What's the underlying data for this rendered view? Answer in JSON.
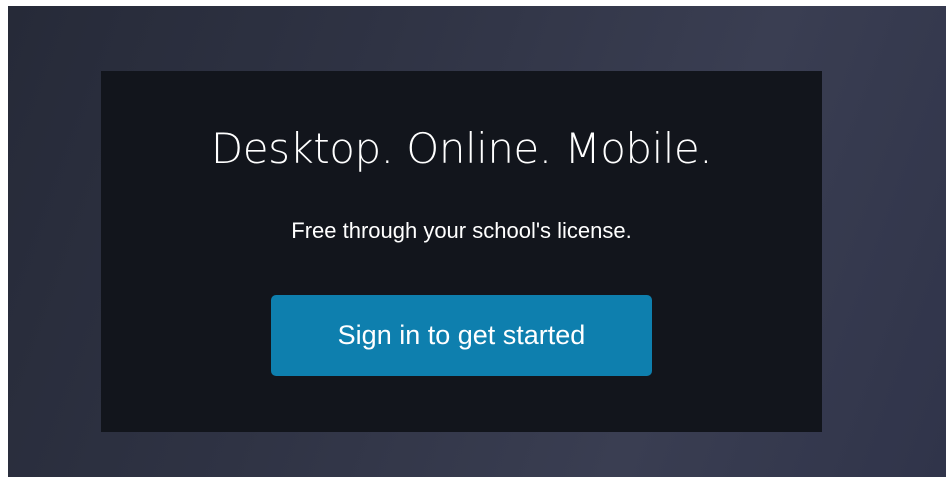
{
  "promo": {
    "headline": "Desktop. Online. Mobile.",
    "subline": "Free through your school's license.",
    "cta_label": "Sign in to get started"
  },
  "colors": {
    "background": "#2f3344",
    "panel": "#12151c",
    "button": "#0e7fae",
    "text": "#ffffff"
  }
}
